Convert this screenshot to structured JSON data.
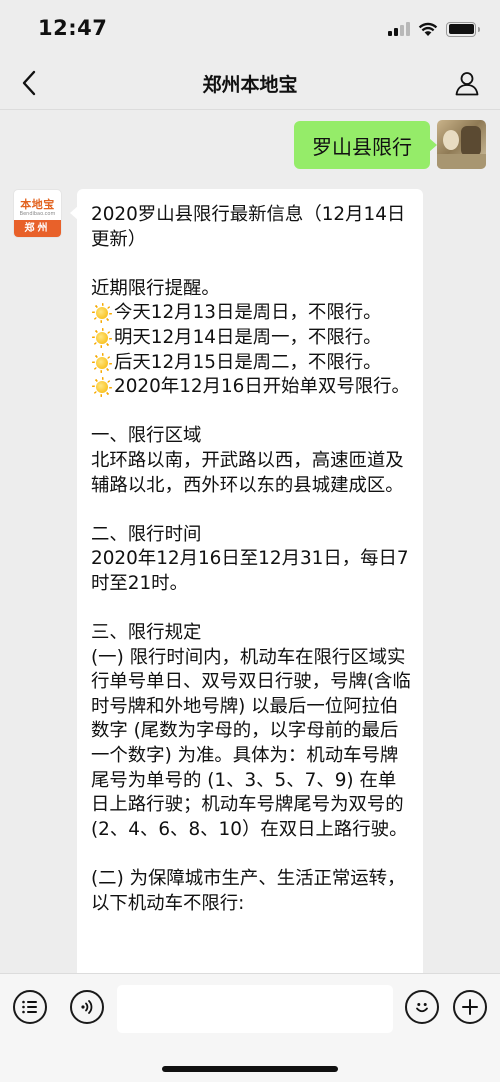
{
  "status_bar": {
    "time": "12:47",
    "signal_bars_filled": 2,
    "signal_bars_total": 4,
    "battery_level": 1.0
  },
  "nav": {
    "title": "郑州本地宝",
    "back_icon": "chevron-left-icon",
    "profile_icon": "person-icon"
  },
  "messages": {
    "sent": {
      "text": "罗山县限行"
    },
    "received": {
      "avatar": {
        "logo_text": "本地宝",
        "logo_sub": "Bendibao.com",
        "badge": "郑州"
      },
      "title": "2020罗山县限行最新信息（12月14日更新）",
      "reminder_heading": "近期限行提醒。",
      "reminders": [
        "今天12月13日是周日，不限行。",
        "明天12月14日是周一，不限行。",
        "后天12月15日是周二，不限行。",
        "2020年12月16日开始单双号限行。"
      ],
      "sections": [
        {
          "heading": "一、限行区域",
          "body": "北环路以南，开武路以西，高速匝道及辅路以北，西外环以东的县城建成区。"
        },
        {
          "heading": "二、限行时间",
          "body": "2020年12月16日至12月31日，每日7时至21时。"
        },
        {
          "heading": "三、限行规定",
          "body": "(一) 限行时间内，机动车在限行区域实行单号单日、双号双日行驶，号牌(含临时号牌和外地号牌) 以最后一位阿拉伯数字 (尾数为字母的，以字母前的最后一个数字) 为准。具体为：机动车号牌尾号为单号的 (1、3、5、7、9) 在单日上路行驶；机动车号牌尾号为双号的 (2、4、6、8、10）在双日上路行驶。"
        },
        {
          "heading": "",
          "body": "(二) 为保障城市生产、生活正常运转，以下机动车不限行:"
        }
      ]
    }
  },
  "input_bar": {
    "message_value": "",
    "voice_icon": "voice-icon",
    "emoji_icon": "emoji-icon",
    "plus_icon": "plus-icon"
  }
}
